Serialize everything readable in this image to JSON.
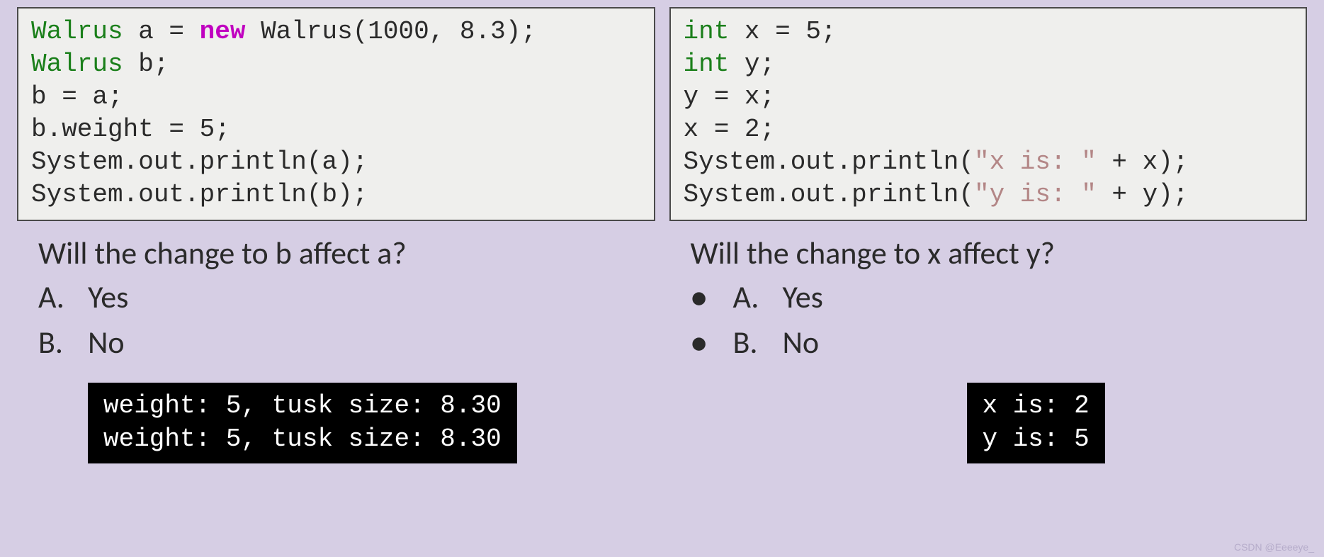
{
  "left": {
    "code": {
      "l1a": "Walrus",
      "l1b": " a = ",
      "l1c": "new",
      "l1d": " Walrus(1000, 8.3);",
      "l2a": "Walrus",
      "l2b": " b;",
      "l3": "b = a;",
      "l4": "b.weight = 5;",
      "l5": "System.out.println(a);",
      "l6": "System.out.println(b);"
    },
    "question": "Will the change to b affect a?",
    "optA_letter": "A.",
    "optA_text": "Yes",
    "optB_letter": "B.",
    "optB_text": "No",
    "output": "weight: 5, tusk size: 8.30\nweight: 5, tusk size: 8.30"
  },
  "right": {
    "code": {
      "l1a": "int",
      "l1b": " x = 5;",
      "l2a": "int",
      "l2b": " y;",
      "l3": "y = x;",
      "l4": "x = 2;",
      "l5a": "System.out.println(",
      "l5b": "\"x is: \"",
      "l5c": " + x);",
      "l6a": "System.out.println(",
      "l6b": "\"y is: \"",
      "l6c": " + y);"
    },
    "question": "Will the change to x affect y?",
    "bullet": "●",
    "optA_letter": "A.",
    "optA_text": "Yes",
    "optB_letter": "B.",
    "optB_text": "No",
    "output": "x is: 2\ny is: 5"
  },
  "watermark": "CSDN @Eeeeye_"
}
